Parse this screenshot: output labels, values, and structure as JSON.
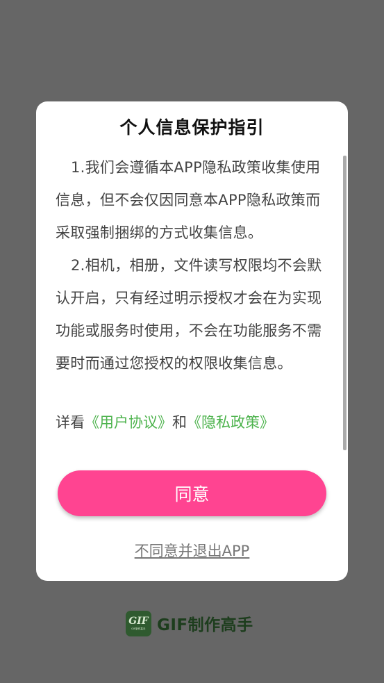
{
  "dialog": {
    "title": "个人信息保护指引",
    "paragraphs": [
      "1.我们会遵循本APP隐私政策收集使用信息，但不会仅因同意本APP隐私政策而采取强制捆绑的方式收集信息。",
      "2.相机，相册，文件读写权限均不会默认开启，只有经过明示授权才会在为实现功能或服务时使用，不会在功能服务不需要时而通过您授权的权限收集信息。"
    ],
    "links_prefix": "详看",
    "user_agreement_link": "《用户协议》",
    "links_join": "和",
    "privacy_policy_link": "《隐私政策》",
    "agree_label": "同意",
    "disagree_label": "不同意并退出APP"
  },
  "brand": {
    "logo_text": "GIF",
    "logo_subtext": "GIF制作高手",
    "name": "GIF制作高手"
  },
  "colors": {
    "overlay": "#666666",
    "agree_button": "#ff4491",
    "link": "#4db34d",
    "brand": "#2f5a2f"
  }
}
